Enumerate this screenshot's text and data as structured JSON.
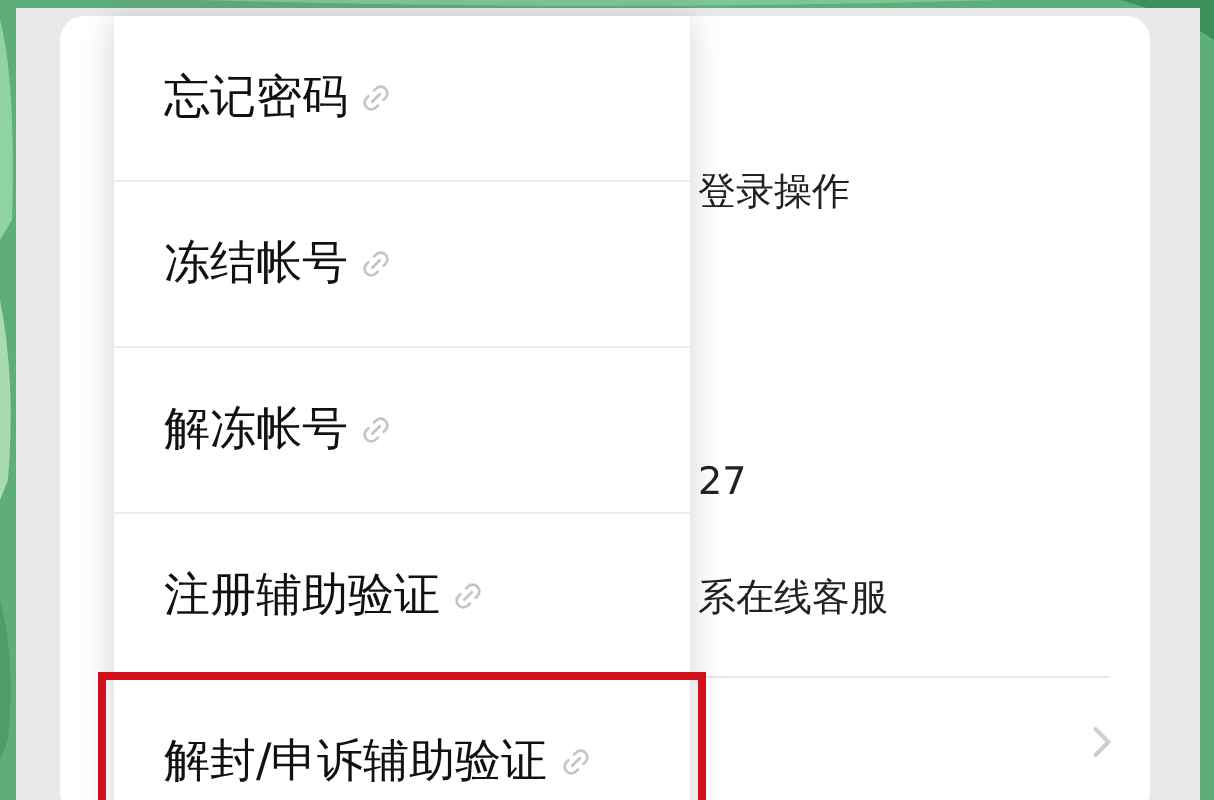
{
  "background_rows": [
    {
      "text": "登录操作"
    },
    {
      "text": "27"
    },
    {
      "text": "系在线客服"
    }
  ],
  "menu": {
    "items": [
      {
        "label": "忘记密码",
        "highlighted": false
      },
      {
        "label": "冻结帐号",
        "highlighted": false
      },
      {
        "label": "解冻帐号",
        "highlighted": false
      },
      {
        "label": "注册辅助验证",
        "highlighted": false
      },
      {
        "label": "解封/申诉辅助验证",
        "highlighted": true
      }
    ]
  }
}
